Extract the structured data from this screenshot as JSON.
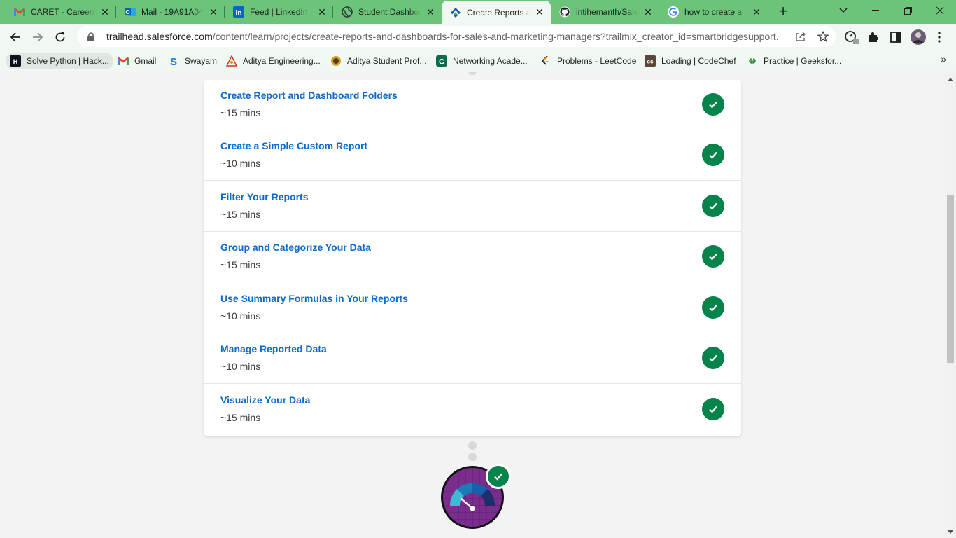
{
  "browser": {
    "tabs": [
      {
        "title": "CARET - Careerne",
        "icon": "gmail-icon",
        "active": false
      },
      {
        "title": "Mail - 19A91A04",
        "icon": "outlook-icon",
        "active": false
      },
      {
        "title": "Feed | LinkedIn",
        "icon": "linkedin-icon",
        "active": false
      },
      {
        "title": "Student Dashboa",
        "icon": "globe-icon",
        "active": false
      },
      {
        "title": "Create Reports a",
        "icon": "trailhead-icon",
        "active": true
      },
      {
        "title": "intihemanth/Sale",
        "icon": "github-icon",
        "active": false
      },
      {
        "title": "how to create a",
        "icon": "google-icon",
        "active": false
      }
    ],
    "new_tab_label": "+",
    "address": {
      "host": "trailhead.salesforce.com",
      "path": "/content/learn/projects/create-reports-and-dashboards-for-sales-and-marketing-managers?trailmix_creator_id=smartbridgesupport..."
    },
    "bookmarks": [
      {
        "label": "Solve Python | Hack...",
        "icon": "hackerrank-icon"
      },
      {
        "label": "Gmail",
        "icon": "gmail-icon"
      },
      {
        "label": "Swayam",
        "icon": "swayam-icon"
      },
      {
        "label": "Aditya Engineering...",
        "icon": "aditya-icon"
      },
      {
        "label": "Aditya Student Prof...",
        "icon": "aditya-student-icon"
      },
      {
        "label": "Networking Acade...",
        "icon": "netacad-icon"
      },
      {
        "label": "Problems - LeetCode",
        "icon": "leetcode-icon"
      },
      {
        "label": "Loading | CodeChef",
        "icon": "codechef-icon"
      },
      {
        "label": "Practice | Geeksfor...",
        "icon": "geeksforgeeks-icon"
      }
    ],
    "bookmarks_overflow": "»"
  },
  "units": [
    {
      "title": "Create Report and Dashboard Folders",
      "duration": "~15 mins",
      "completed": true
    },
    {
      "title": "Create a Simple Custom Report",
      "duration": "~10 mins",
      "completed": true
    },
    {
      "title": "Filter Your Reports",
      "duration": "~15 mins",
      "completed": true
    },
    {
      "title": "Group and Categorize Your Data",
      "duration": "~15 mins",
      "completed": true
    },
    {
      "title": "Use Summary Formulas in Your Reports",
      "duration": "~10 mins",
      "completed": true
    },
    {
      "title": "Manage Reported Data",
      "duration": "~10 mins",
      "completed": true
    },
    {
      "title": "Visualize Your Data",
      "duration": "~15 mins",
      "completed": true
    }
  ],
  "badge": {
    "icon": "dashboard-gauge-badge-icon",
    "completed": true
  },
  "colors": {
    "tab_strip": "#6bc47a",
    "toolbar": "#f1f8f2",
    "link_blue": "#0b6bcb",
    "success_green": "#04844b",
    "badge_purple": "#7b2d8e"
  }
}
